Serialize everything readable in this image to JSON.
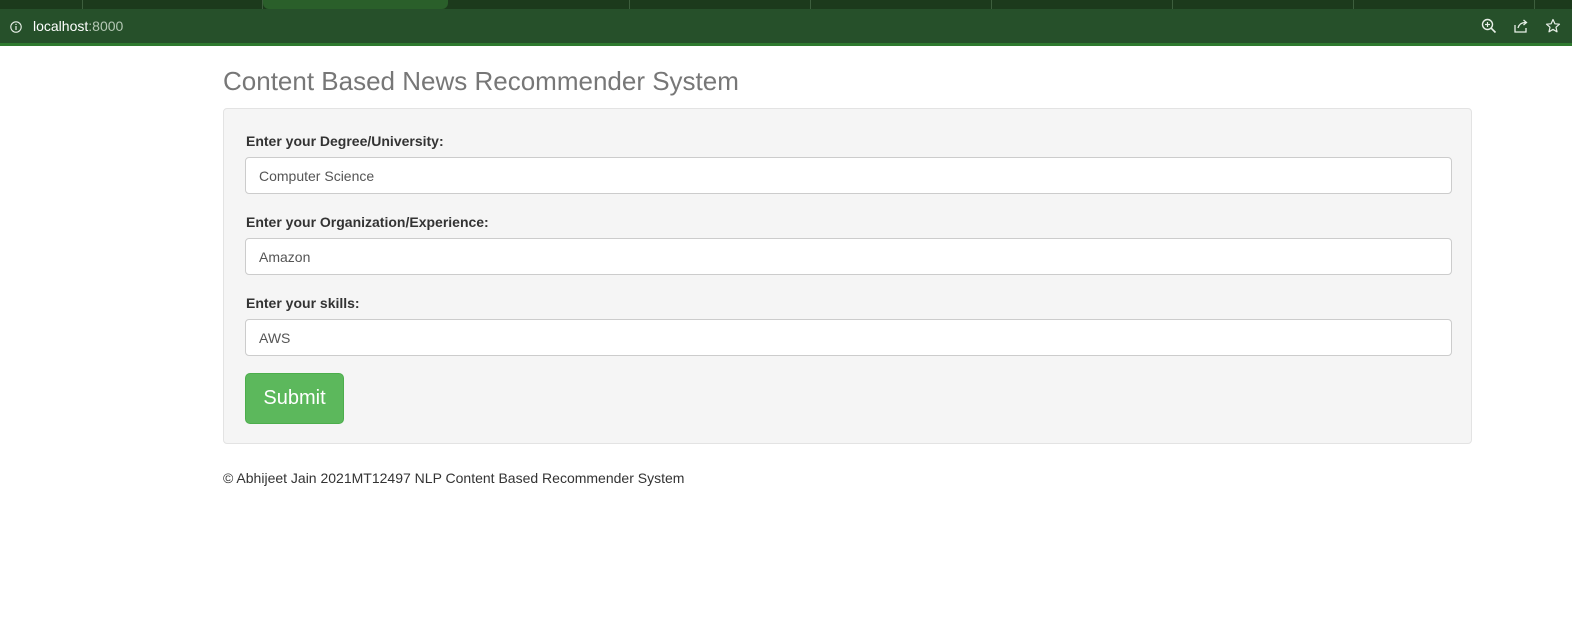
{
  "browser": {
    "url_host": "localhost",
    "url_port": ":8000",
    "icons": {
      "info": "info-icon",
      "zoom": "zoom-icon",
      "share": "share-icon",
      "bookmark": "star-icon"
    },
    "theme_colors": {
      "tabstrip": "#1c3a1c",
      "toolbar": "#26502a",
      "active_tab": "#2a5f2a"
    }
  },
  "page": {
    "title": "Content Based News Recommender System",
    "form": {
      "degree": {
        "label": "Enter your Degree/University:",
        "value": "Computer Science"
      },
      "organization": {
        "label": "Enter your Organization/Experience:",
        "value": "Amazon"
      },
      "skills": {
        "label": "Enter your skills:",
        "value": "AWS"
      },
      "submit_label": "Submit"
    },
    "footer": "© Abhijeet Jain 2021MT12497 NLP Content Based Recommender System"
  },
  "colors": {
    "submit_button": "#5cb85c",
    "panel_background": "#f5f5f5",
    "title_text": "#777777"
  }
}
